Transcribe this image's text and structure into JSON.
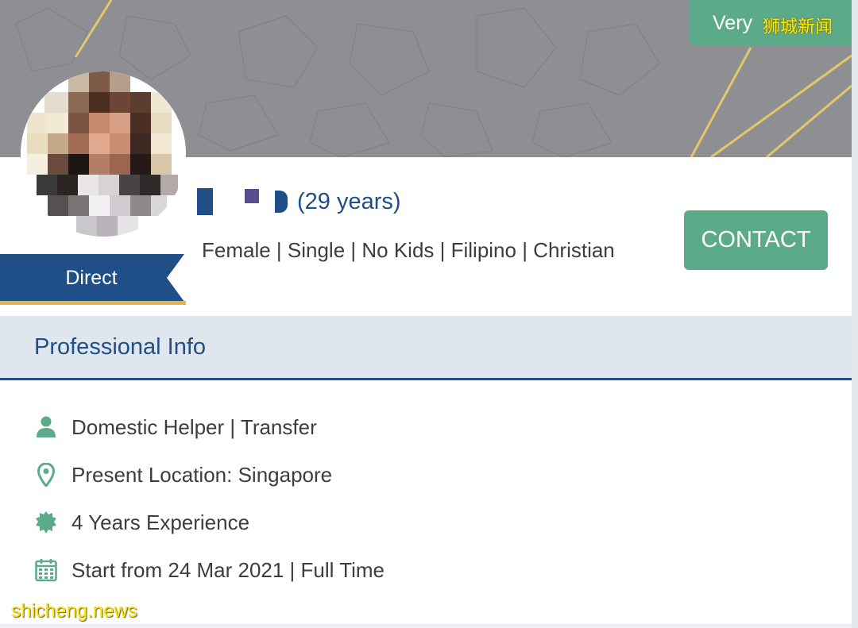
{
  "badge": {
    "label": "Very"
  },
  "profile": {
    "age_text": "(29 years)",
    "details": "Female | Single | No Kids | Filipino | Christian",
    "tag": "Direct",
    "contact_label": "CONTACT"
  },
  "section": {
    "title": "Professional Info"
  },
  "info_items": [
    {
      "icon": "person-icon",
      "text": "Domestic Helper | Transfer"
    },
    {
      "icon": "location-pin-icon",
      "text": "Present Location: Singapore"
    },
    {
      "icon": "badge-star-icon",
      "text": "4 Years Experience"
    },
    {
      "icon": "calendar-icon",
      "text": "Start from 24 Mar 2021 | Full Time"
    }
  ],
  "watermarks": {
    "top": "狮城新闻",
    "bottom": "shicheng.news"
  },
  "colors": {
    "accent_green": "#5bab8a",
    "navy": "#1f4f86",
    "gold": "#e2b64a",
    "section_bg": "#dfe6ed"
  }
}
